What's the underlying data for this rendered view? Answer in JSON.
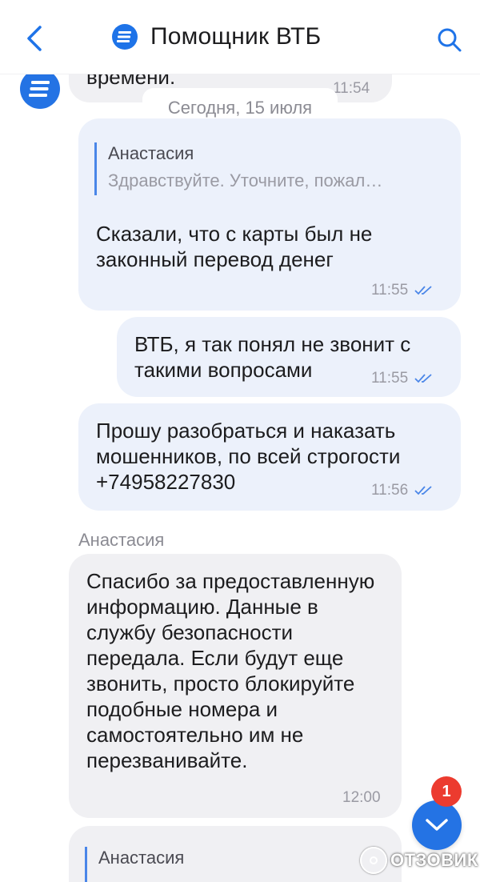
{
  "header": {
    "title": "Помощник ВТБ",
    "back_icon": "chevron-left-icon",
    "search_icon": "search-icon",
    "accent_color": "#1e73e8"
  },
  "chat": {
    "date_separator": "Сегодня, 15 июля",
    "messages": [
      {
        "direction": "incoming",
        "text_partial": "времени.",
        "time": "11:54"
      },
      {
        "direction": "outgoing",
        "quote": {
          "author": "Анастасия",
          "text": "Здравствуйте.  Уточните, пожал…"
        },
        "text": "Сказали, что с карты был не законный перевод денег",
        "time": "11:55",
        "status": "read"
      },
      {
        "direction": "outgoing",
        "text": "ВТБ, я так понял не звонит с такими вопросами",
        "time": "11:55",
        "status": "read"
      },
      {
        "direction": "outgoing",
        "text": "Прошу разобраться и наказать мошенников, по всей строгости +74958227830",
        "time": "11:56",
        "status": "read"
      },
      {
        "direction": "incoming",
        "sender": "Анастасия",
        "text": "Спасибо за предоставленную информацию. Данные в службу безопасности передала. Если будут еще звонить, просто блокируйте подобные номера и самостоятельно им не перезванивайте.",
        "time": "12:00"
      },
      {
        "direction": "incoming",
        "quote_author_partial": "Анастасия"
      }
    ]
  },
  "scroll_button": {
    "icon": "chevron-down-icon",
    "badge": "1"
  },
  "watermark": {
    "text": "ОТЗОВИК"
  }
}
